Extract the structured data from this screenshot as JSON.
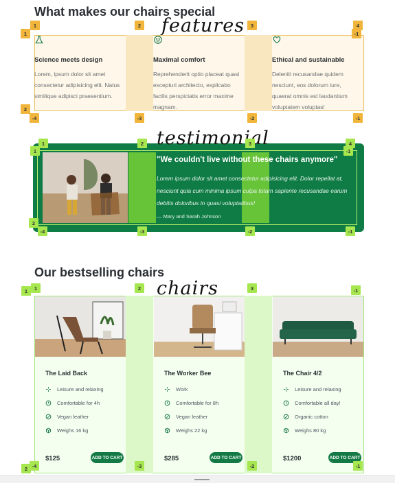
{
  "sections": {
    "features_heading": "What makes our chairs special",
    "chairs_heading": "Our bestselling chairs"
  },
  "annotations": {
    "features": "features",
    "testimonial": "testimonial",
    "chairs": "chairs"
  },
  "features": [
    {
      "icon": "flask-icon",
      "title": "Science meets design",
      "text": "Lorem, ipsum dolor sit amet consectetur adipisicing elit. Natus similique adipisci praesentium."
    },
    {
      "icon": "smiley-icon",
      "title": "Maximal comfort",
      "text": "Reprehenderit optio placeat quasi excepturi architecto, explicabo facilis perspiciatis error maxime magnam."
    },
    {
      "icon": "heart-icon",
      "title": "Ethical and sustainable",
      "text": "Deleniti recusandae quidem nesciunt, eos dolorum iure, quaerat omnis est laudantium voluptatem voluptas!"
    }
  ],
  "testimonial": {
    "quote": "\"We couldn't live without these chairs anymore\"",
    "body": "Lorem ipsum dolor sit amet consectetur adipisicing elit. Dolor repellat at, nesciunt quia cum minima ipsum culpa totam sapiente recusandae earum debitis doloribus in quasi voluptatibus!",
    "author": "— Mary and Sarah Johnson"
  },
  "chairs": [
    {
      "name": "The Laid Back",
      "features": [
        "Leisure and relaxing",
        "Comfortable for 4h",
        "Vegan leather",
        "Weighs 16 kg"
      ],
      "price": "$125",
      "button": "ADD TO CART"
    },
    {
      "name": "The Worker Bee",
      "features": [
        "Work",
        "Comfortable for 8h",
        "Vegan leather",
        "Weighs 22 kg"
      ],
      "price": "$285",
      "button": "ADD TO CART"
    },
    {
      "name": "The Chair 4/2",
      "features": [
        "Leisure and relaxing",
        "Comfortable all day!",
        "Organic cotton",
        "Weighs 80 kg"
      ],
      "price": "$1200",
      "button": "ADD TO CART"
    }
  ],
  "grid_badges": {
    "features": [
      "1",
      "2",
      "3",
      "4",
      "1",
      "-1",
      "2",
      "-4",
      "-3",
      "-2",
      "-1"
    ],
    "testimonial": [
      "1",
      "1",
      "2",
      "3",
      "4",
      "-1",
      "2",
      "-4",
      "-3",
      "-2",
      "-1"
    ],
    "chairs": [
      "1",
      "1",
      "2",
      "3",
      "-1",
      "2",
      "-4",
      "-3",
      "-2",
      "-1"
    ]
  },
  "colors": {
    "brand_green": "#137a45",
    "features_grid": "#f0b53a",
    "testimonial_grid": "#a6e64e",
    "chairs_grid": "#a4e57d"
  }
}
